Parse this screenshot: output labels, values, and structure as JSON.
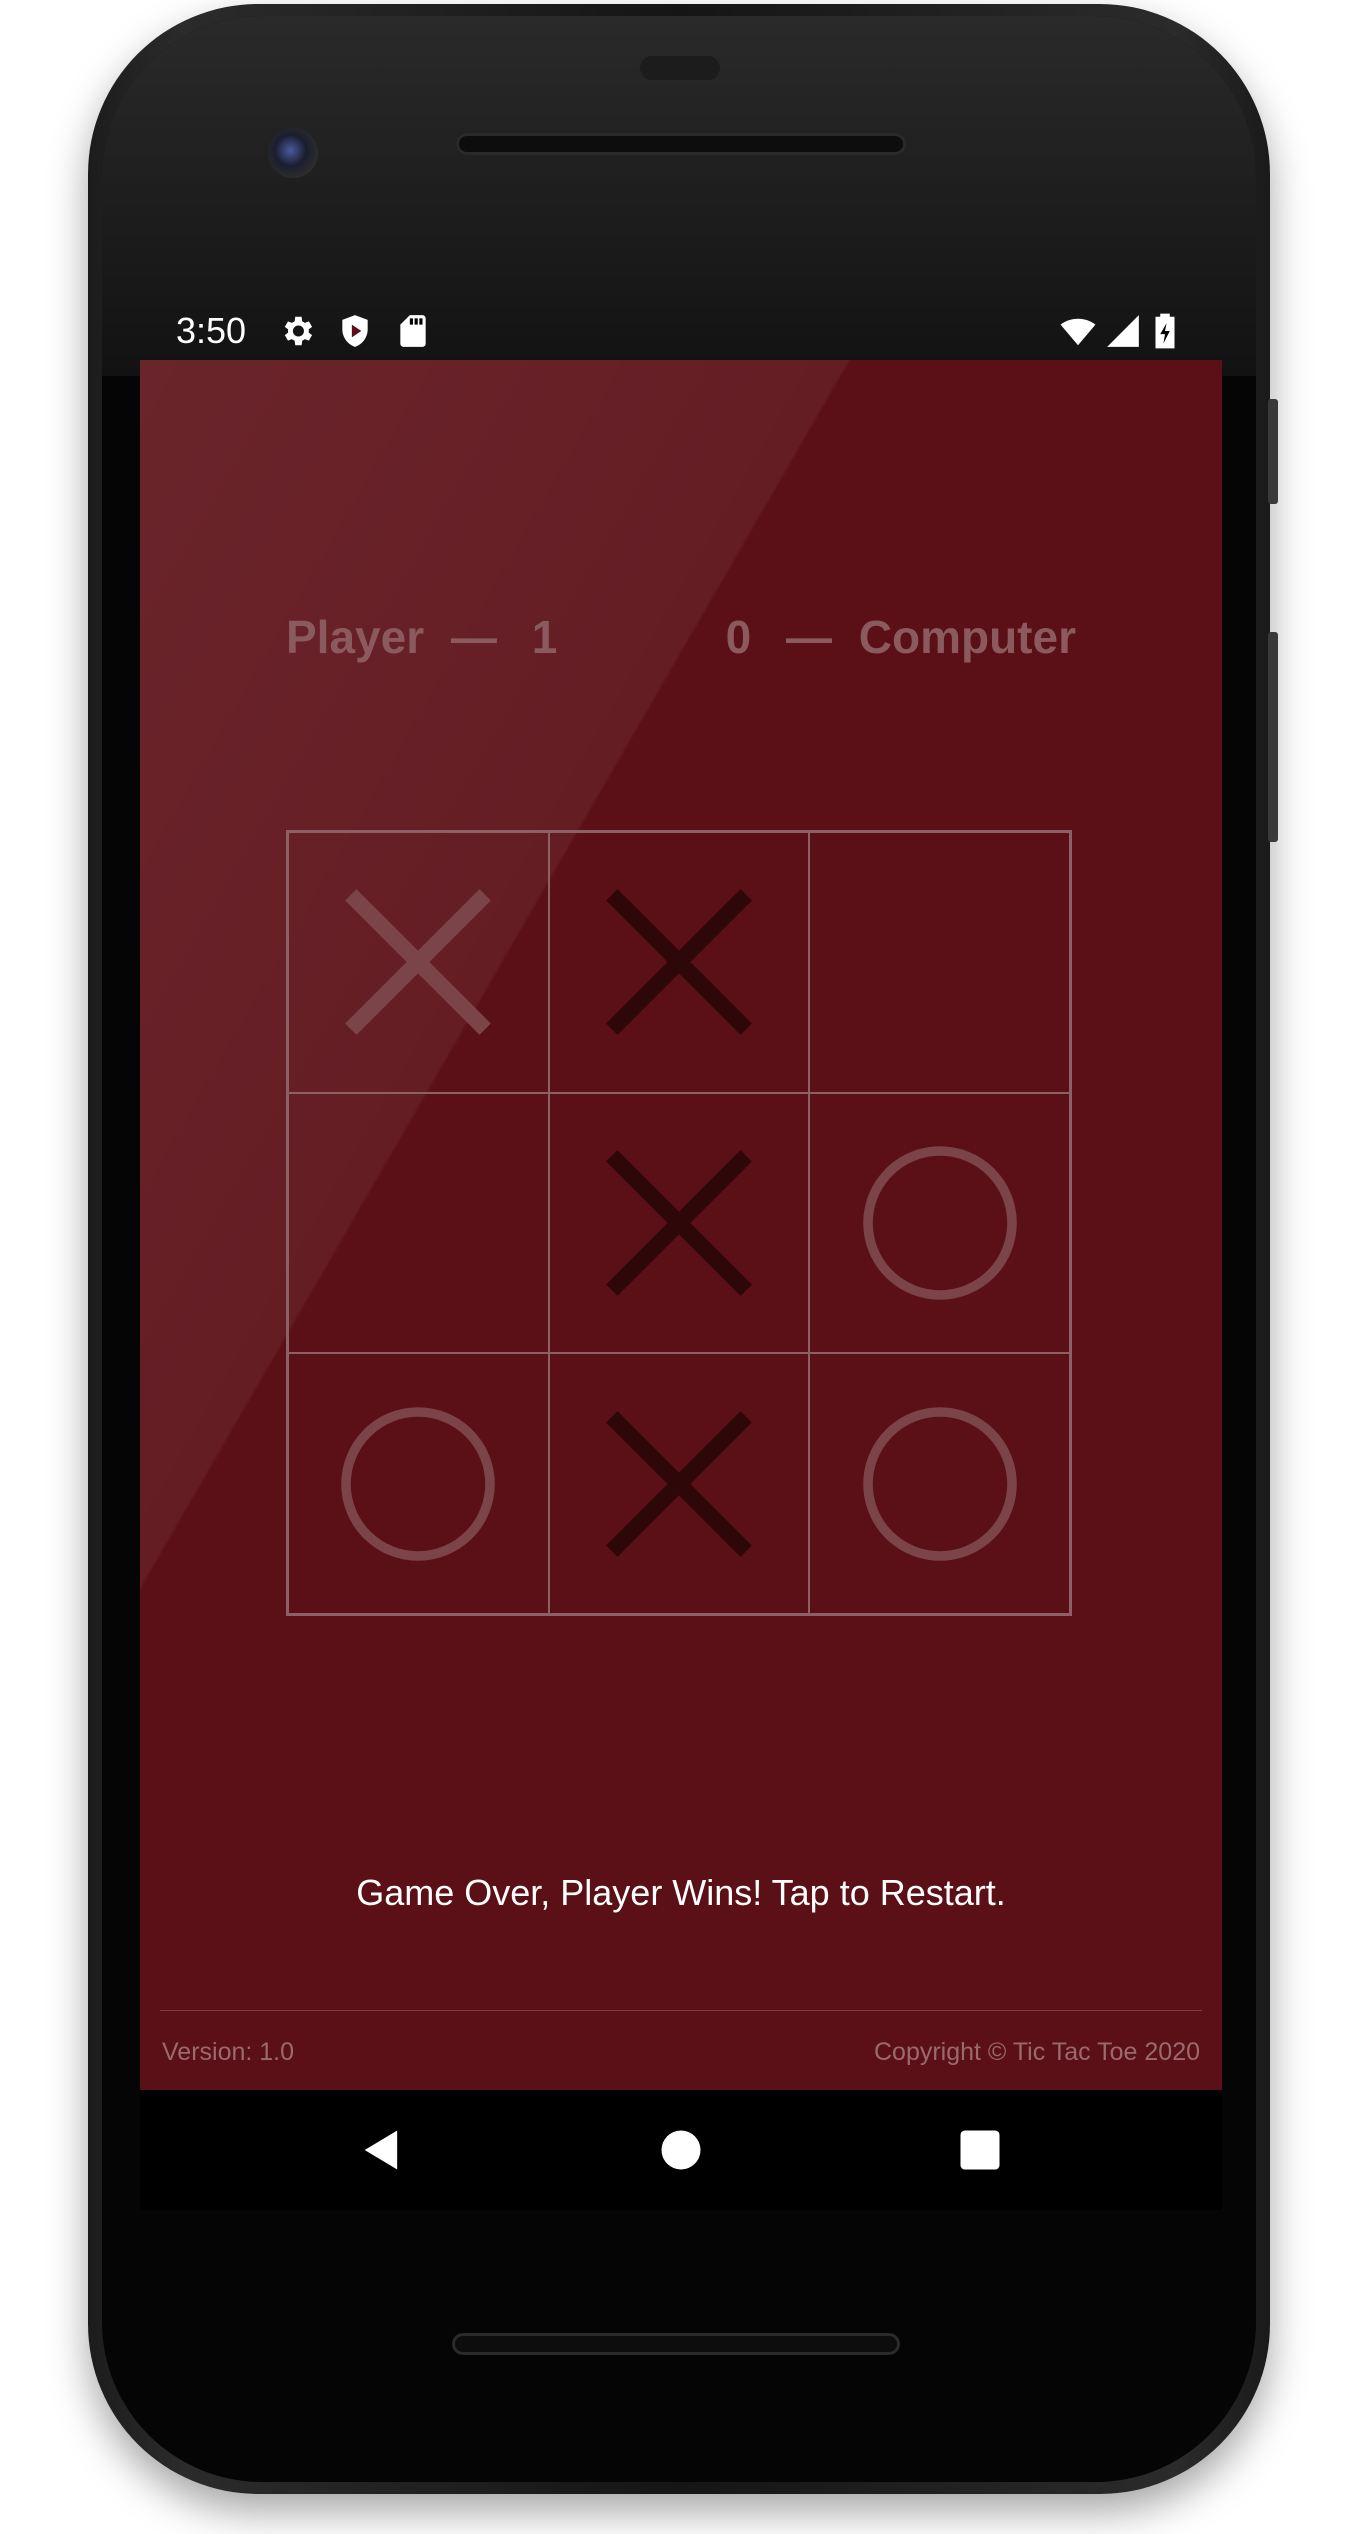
{
  "status_bar": {
    "time": "3:50",
    "left_icons": [
      "gear-icon",
      "shield-play-icon",
      "sd-card-icon"
    ],
    "right_icons": [
      "wifi-icon",
      "signal-icon",
      "battery-charging-icon"
    ]
  },
  "scoreboard": {
    "player_label": "Player",
    "player_score": "1",
    "computer_label": "Computer",
    "computer_score": "0",
    "separator": "—"
  },
  "board": {
    "cells": [
      {
        "mark": "X",
        "style": "highlighted"
      },
      {
        "mark": "X",
        "style": "dark"
      },
      {
        "mark": "",
        "style": "empty"
      },
      {
        "mark": "",
        "style": "empty"
      },
      {
        "mark": "X",
        "style": "dark"
      },
      {
        "mark": "O",
        "style": "normal"
      },
      {
        "mark": "O",
        "style": "normal"
      },
      {
        "mark": "X",
        "style": "dark"
      },
      {
        "mark": "O",
        "style": "normal"
      }
    ]
  },
  "message": "Game Over, Player Wins! Tap to Restart.",
  "footer": {
    "version": "Version: 1.0",
    "copyright": "Copyright © Tic Tac Toe 2020"
  },
  "navigation": {
    "buttons": [
      "back-icon",
      "home-icon",
      "recents-icon"
    ]
  },
  "colors": {
    "background": "#5b0f16",
    "score_text": "#8b5a5e",
    "grid_line": "#8a6266",
    "mark_highlighted": "#7a4448",
    "mark_dark": "#2e0709",
    "mark_normal": "#7a4448",
    "message_text": "#ffffff",
    "footer_text": "#9a6a6e"
  }
}
